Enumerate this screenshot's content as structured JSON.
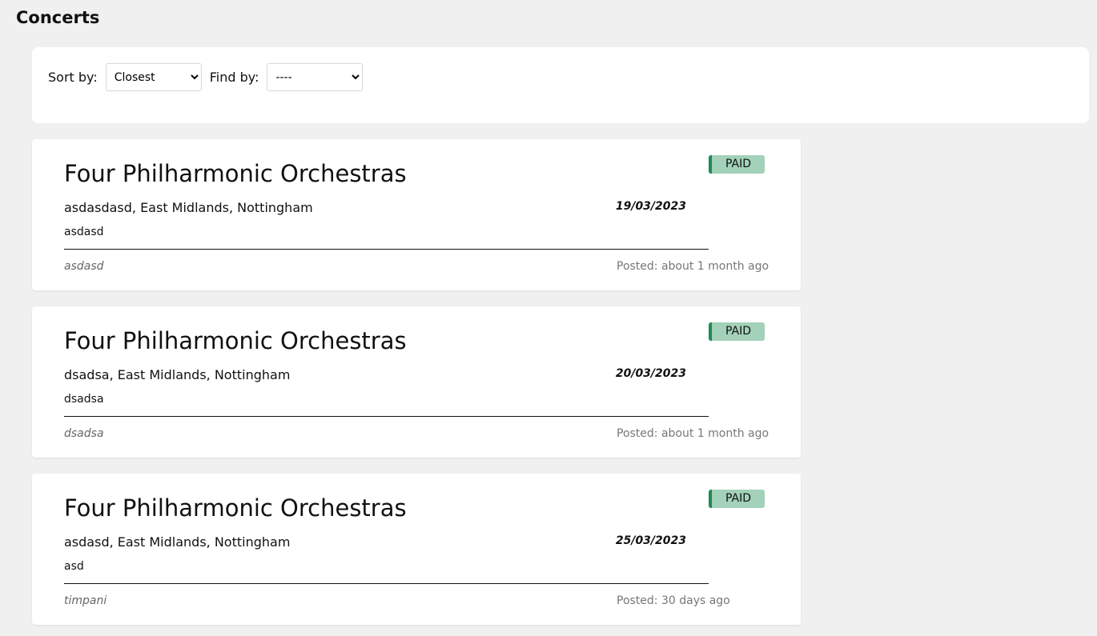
{
  "page_title": "Concerts",
  "filters": {
    "sort_label": "Sort by:",
    "sort_value": "Closest",
    "find_label": "Find by:",
    "find_value": "----"
  },
  "concerts": [
    {
      "title": "Four Philharmonic Orchestras",
      "location": "asdasdasd, East Midlands, Nottingham",
      "description": "asdasd",
      "date": "19/03/2023",
      "author": "asdasd",
      "posted": "Posted: about 1 month ago",
      "badge": "PAID"
    },
    {
      "title": "Four Philharmonic Orchestras",
      "location": "dsadsa, East Midlands, Nottingham",
      "description": "dsadsa",
      "date": "20/03/2023",
      "author": "dsadsa",
      "posted": "Posted: about 1 month ago",
      "badge": "PAID"
    },
    {
      "title": "Four Philharmonic Orchestras",
      "location": "asdasd, East Midlands, Nottingham",
      "description": "asd",
      "date": "25/03/2023",
      "author": "timpani",
      "posted": "Posted: 30 days ago",
      "badge": "PAID"
    }
  ],
  "colors": {
    "badge_bg": "#a3d1b9",
    "badge_accent": "#1e8a55"
  }
}
